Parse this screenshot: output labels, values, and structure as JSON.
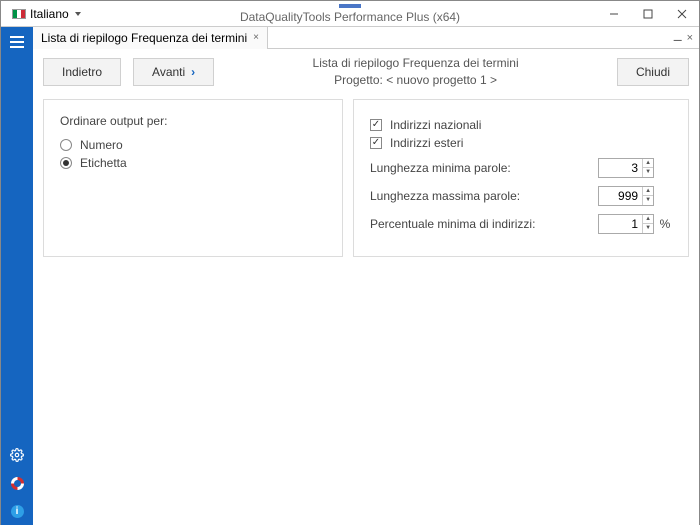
{
  "titlebar": {
    "language": "Italiano",
    "appTitle": "DataQualityTools Performance Plus (x64)"
  },
  "tab": {
    "title": "Lista di riepilogo Frequenza dei termini"
  },
  "tabStrip": {
    "pin": "⚊",
    "close": "×"
  },
  "page": {
    "backLabel": "Indietro",
    "nextLabel": "Avanti",
    "closeLabel": "Chiudi",
    "headerLine1": "Lista di riepilogo Frequenza dei termini",
    "headerLine2": "Progetto: < nuovo progetto 1 >"
  },
  "sortPanel": {
    "title": "Ordinare output per:",
    "options": {
      "number": "Numero",
      "label": "Etichetta"
    },
    "selected": "label"
  },
  "addressPanel": {
    "national": {
      "label": "Indirizzi nazionali",
      "checked": true
    },
    "foreign": {
      "label": "Indirizzi esteri",
      "checked": true
    },
    "minLenLabel": "Lunghezza minima parole:",
    "minLenValue": "3",
    "maxLenLabel": "Lunghezza massima parole:",
    "maxLenValue": "999",
    "minPctLabel": "Percentuale minima di indirizzi:",
    "minPctValue": "1",
    "pctSuffix": "%"
  },
  "sidebar": {
    "infoGlyph": "i"
  }
}
